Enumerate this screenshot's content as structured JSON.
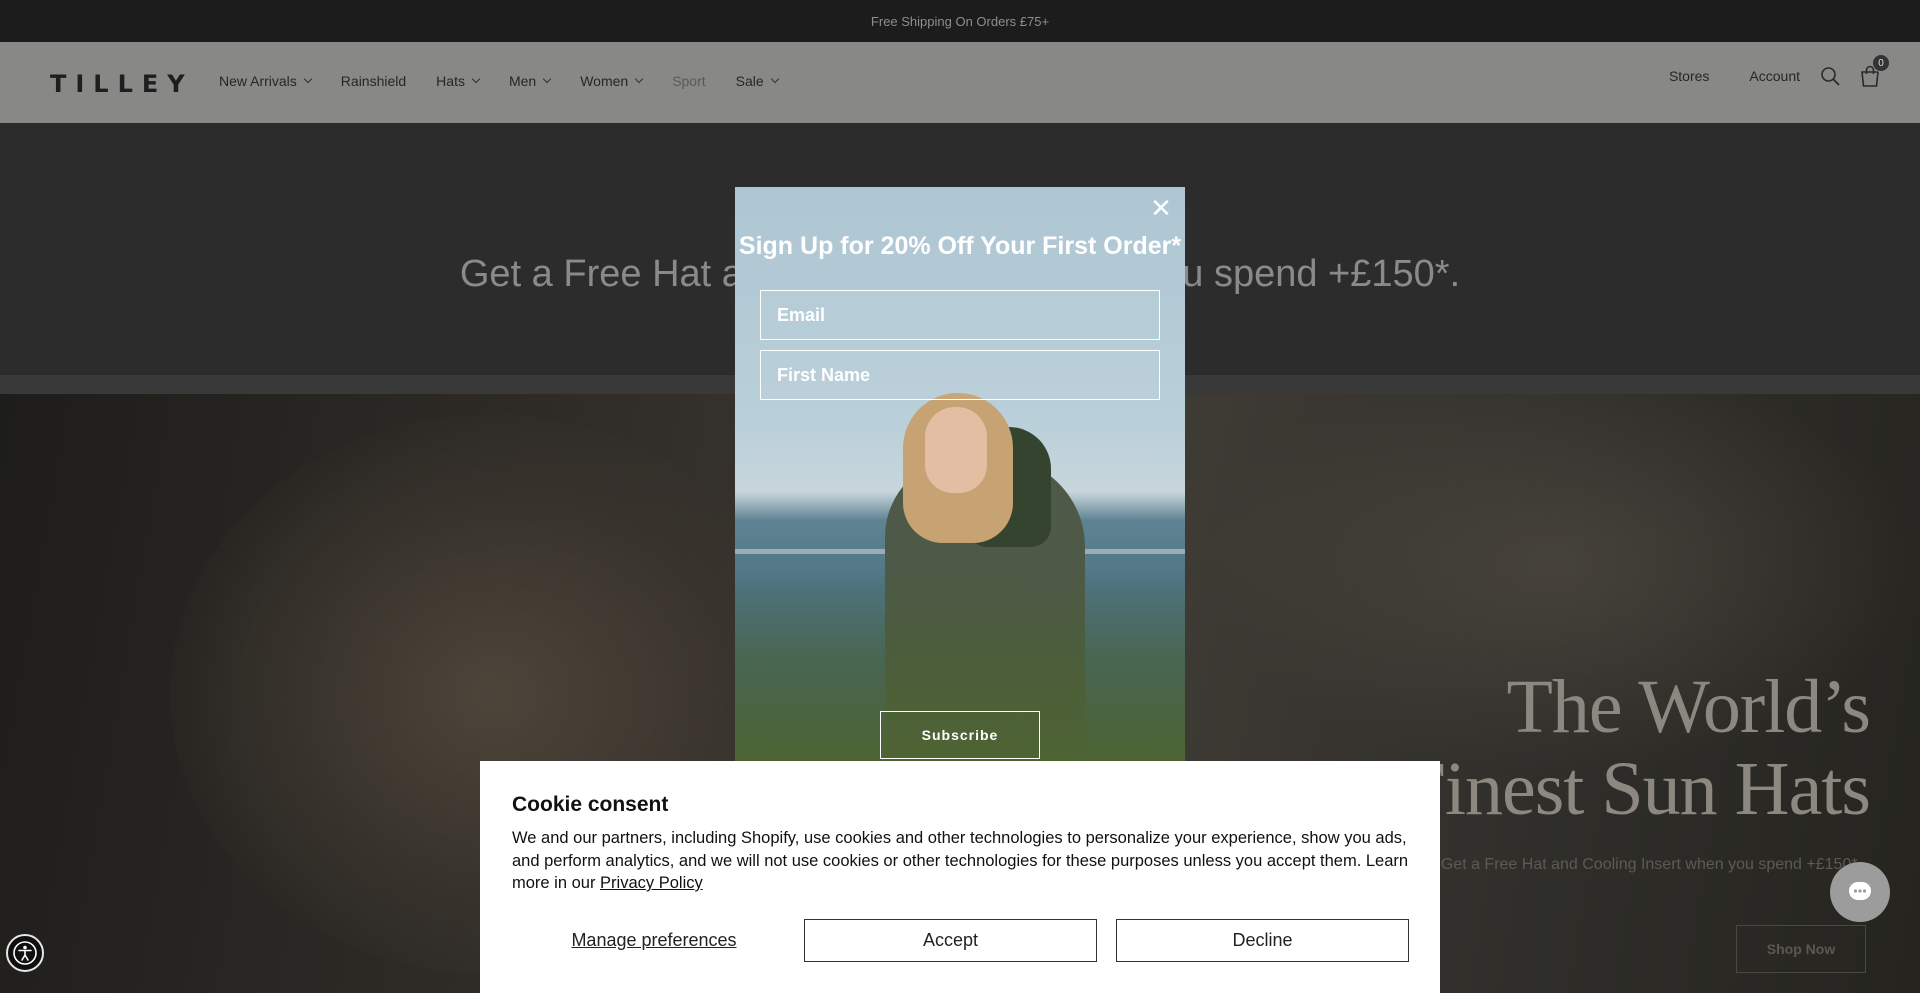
{
  "announcement": {
    "text": "Free Shipping On Orders £75+"
  },
  "header": {
    "logo": "TILLEY",
    "nav": [
      {
        "label": "New Arrivals",
        "dropdown": true
      },
      {
        "label": "Rainshield",
        "dropdown": false
      },
      {
        "label": "Hats",
        "dropdown": true
      },
      {
        "label": "Men",
        "dropdown": true
      },
      {
        "label": "Women",
        "dropdown": true
      },
      {
        "label": "Sport",
        "dropdown": false
      },
      {
        "label": "Sale",
        "dropdown": true
      }
    ],
    "stores_label": "Stores",
    "account_label": "Account",
    "cart_count": "0"
  },
  "promo": {
    "text": "Get a Free Hat and Cooling Insert when you spend +£150*."
  },
  "hero": {
    "title_line1": "The World’s",
    "title_line2": "Finest Sun Hats",
    "subtitle": "Get a Free Hat and Cooling Insert when you spend +£150*.",
    "cta": "Shop Now"
  },
  "signup_modal": {
    "title": "Sign Up for 20% Off Your First Order*",
    "email_placeholder": "Email",
    "first_name_placeholder": "First Name",
    "subscribe_label": "Subscribe",
    "close_label": "✕"
  },
  "cookie_consent": {
    "title": "Cookie consent",
    "body": "We and our partners, including Shopify, use cookies and other technologies to personalize your experience, show you ads, and perform analytics, and we will not use cookies or other technologies for these purposes unless you accept them. Learn more in our ",
    "privacy_link": "Privacy Policy",
    "manage_label": "Manage preferences",
    "accept_label": "Accept",
    "decline_label": "Decline"
  },
  "icons": {
    "search": "search-icon",
    "cart": "cart-icon",
    "close": "close-icon",
    "chat": "chat-icon",
    "accessibility": "accessibility-icon"
  },
  "colors": {
    "announcement_bg": "#1c1c1c",
    "header_bg": "#888887",
    "cookie_bg": "#ffffff",
    "modal_text": "#ffffff"
  }
}
